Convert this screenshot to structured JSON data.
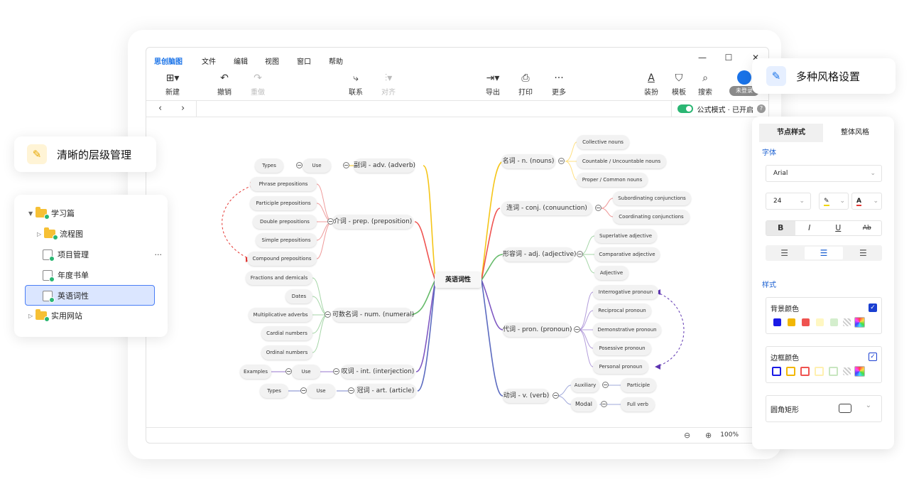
{
  "app": {
    "brand": "思创脑图",
    "menus": [
      "文件",
      "编辑",
      "视图",
      "窗口",
      "帮助"
    ],
    "window_controls": [
      "—",
      "☐",
      "✕"
    ]
  },
  "toolbar": {
    "new": "新建",
    "undo": "撤销",
    "redo": "重做",
    "connect": "联系",
    "align": "对齐",
    "export": "导出",
    "print": "打印",
    "more": "更多",
    "dress": "装扮",
    "template": "模板",
    "search": "搜索",
    "login": "未登录"
  },
  "navbar": {
    "back": "‹",
    "forward": "›",
    "formula_label": "公式模式 · 已开启",
    "help": "?"
  },
  "status": {
    "zoom": "100%"
  },
  "mindmap": {
    "root": "英语词性",
    "left": {
      "adverb": "副词 - adv. (adverb)",
      "adverb_use": "Use",
      "adverb_types": "Types",
      "prep": "介词 - prep. (preposition)",
      "prep_items": [
        "Phrase prepositions",
        "Participle prepositions",
        "Double prepositions",
        "Simple prepositions",
        "Compound prepositions"
      ],
      "numeral": "可数名词 - num. (numeral)",
      "numeral_items": [
        "Fractions and demicals",
        "Dates",
        "Multiplicative adverbs",
        "Cardial numbers",
        "Ordinal numbers"
      ],
      "interjection": "叹词 - int. (interjection)",
      "interjection_use": "Use",
      "interjection_examples": "Examples",
      "article": "冠词 - art. (article)",
      "article_use": "Use",
      "article_types": "Types"
    },
    "right": {
      "nouns": "名词 - n. (nouns)",
      "nouns_items": [
        "Collective nouns",
        "Countable / Uncountable nouns",
        "Proper / Common nouns"
      ],
      "conj": "连词 - conj. (conuunction)",
      "conj_items": [
        "Subordinating conjunctions",
        "Coordinating conjunctions"
      ],
      "adj": "形容词 - adj. (adjective)",
      "adj_items": [
        "Superlative adjective",
        "Comparative adjective",
        "Adjective"
      ],
      "pron": "代词 - pron. (pronoun)",
      "pron_items": [
        "Interrogative pronoun",
        "Reciprocal pronoun",
        "Demonstrative pronoun",
        "Posessive pronoun",
        "Personal pronoun"
      ],
      "verb": "动词 - v. (verb)",
      "verb_aux": "Auxiliary",
      "verb_participle": "Participle",
      "verb_modal": "Modal",
      "verb_full": "Full  verb"
    }
  },
  "badges": {
    "style_settings": "多种风格设置",
    "hierarchy": "清晰的层级管理"
  },
  "tree": {
    "items": [
      {
        "label": "学习篇"
      },
      {
        "label": "流程图"
      },
      {
        "label": "项目管理",
        "more": "···"
      },
      {
        "label": "年度书单"
      },
      {
        "label": "英语词性"
      },
      {
        "label": "实用网站"
      }
    ]
  },
  "style_panel": {
    "tabs": [
      "节点样式",
      "整体风格"
    ],
    "font_section": "字体",
    "font_family": "Arial",
    "font_size": "24",
    "highlight_icon": "✎",
    "font_color_letter": "A",
    "format_buttons": [
      "B",
      "I",
      "U",
      "Ab"
    ],
    "style_section": "样式",
    "bg_color_label": "背景颜色",
    "border_color_label": "边框颜色",
    "shape_label": "圆角矩形",
    "swatches": [
      "#1a1ae6",
      "#f2b705",
      "#ef5350",
      "#fff7c2",
      "#d4eecd"
    ]
  }
}
